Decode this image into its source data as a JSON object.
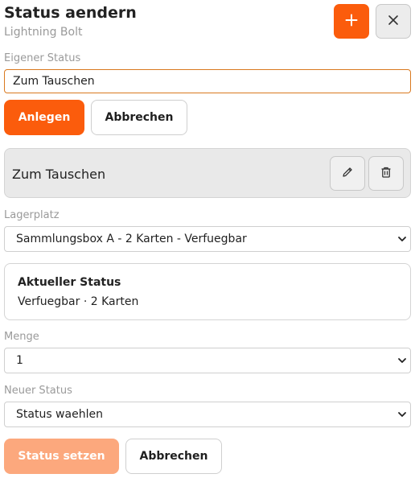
{
  "header": {
    "title": "Status aendern",
    "subtitle": "Lightning Bolt",
    "add_icon": "plus-icon",
    "close_icon": "close-icon"
  },
  "custom_status": {
    "label": "Eigener Status",
    "value": "Zum Tauschen",
    "create_label": "Anlegen",
    "cancel_label": "Abbrechen"
  },
  "status_item": {
    "name": "Zum Tauschen",
    "edit_icon": "pencil-icon",
    "delete_icon": "trash-icon"
  },
  "storage": {
    "label": "Lagerplatz",
    "selected": "Sammlungsbox A - 2 Karten - Verfuegbar"
  },
  "current_status": {
    "heading": "Aktueller Status",
    "value": "Verfuegbar · 2 Karten"
  },
  "quantity": {
    "label": "Menge",
    "selected": "1"
  },
  "new_status": {
    "label": "Neuer Status",
    "selected": "Status waehlen"
  },
  "footer": {
    "submit_label": "Status setzen",
    "submit_disabled": true,
    "cancel_label": "Abbrechen"
  },
  "colors": {
    "accent": "#fb5c0c",
    "accent_disabled": "#fca87d",
    "input_focus_border": "#d9791f"
  }
}
